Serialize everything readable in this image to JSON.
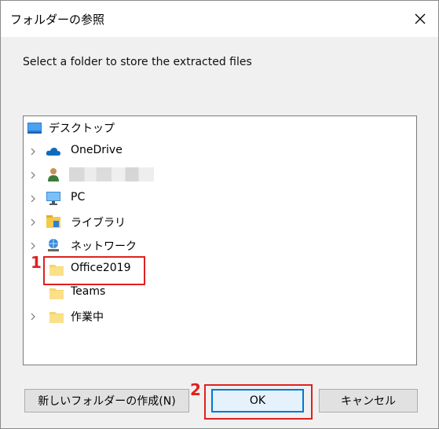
{
  "window": {
    "title": "フォルダーの参照"
  },
  "prompt": "Select a folder to store the extracted files",
  "tree": [
    {
      "label": "デスクトップ",
      "icon": "desktop-icon",
      "expandable": false
    },
    {
      "label": "OneDrive",
      "icon": "onedrive-cloud-icon",
      "expandable": true
    },
    {
      "label": "",
      "icon": "user-icon",
      "expandable": true
    },
    {
      "label": "PC",
      "icon": "pc-monitor-icon",
      "expandable": true
    },
    {
      "label": "ライブラリ",
      "icon": "libraries-icon",
      "expandable": true
    },
    {
      "label": "ネットワーク",
      "icon": "network-icon",
      "expandable": true
    },
    {
      "label": "Office2019",
      "icon": "folder-icon",
      "expandable": false,
      "highlighted": true
    },
    {
      "label": "Teams",
      "icon": "folder-icon",
      "expandable": false
    },
    {
      "label": "作業中",
      "icon": "folder-icon",
      "expandable": true
    }
  ],
  "annotations": {
    "step1": "1",
    "step2": "2"
  },
  "buttons": {
    "new_folder": "新しいフォルダーの作成(N)",
    "ok": "OK",
    "cancel": "キャンセル"
  },
  "colors": {
    "highlight": "#e02020",
    "accent": "#0078d7"
  }
}
